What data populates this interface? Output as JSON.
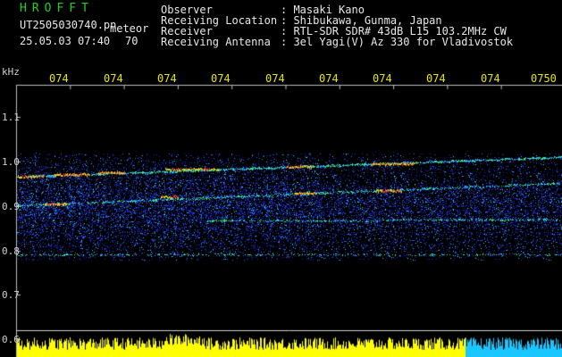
{
  "header": {
    "title": "HROFFT",
    "filename": "UT2505030740.pn",
    "type_label": "meteor",
    "date_time": "25.05.03 07:40",
    "count": "70",
    "info_labels": [
      "Observer",
      "Receiving Location",
      "Receiver",
      "Receiving Antenna"
    ],
    "info_values": [
      ": Masaki Kano",
      ": Shibukawa, Gunma, Japan",
      ": RTL-SDR SDR# 43dB L15 103.2MHz CW",
      ": 3el Yagi(V) Az 330 for Vladivostok"
    ]
  },
  "time_axis": {
    "labels": [
      "074",
      "074",
      "074",
      "074",
      "074",
      "074",
      "074",
      "074",
      "074",
      "0750"
    ]
  },
  "freq_axis": {
    "unit": "kHz",
    "labels": [
      "1.1",
      "1.0",
      "0.9",
      "0.8",
      "0.7",
      "0.6"
    ]
  },
  "colors": {
    "title": "#19d419",
    "header_text": "#e8e8e8",
    "tick_labels": "#e6e600",
    "level_bars": "#ffff00",
    "level_bars_right": "#00ccff"
  }
}
